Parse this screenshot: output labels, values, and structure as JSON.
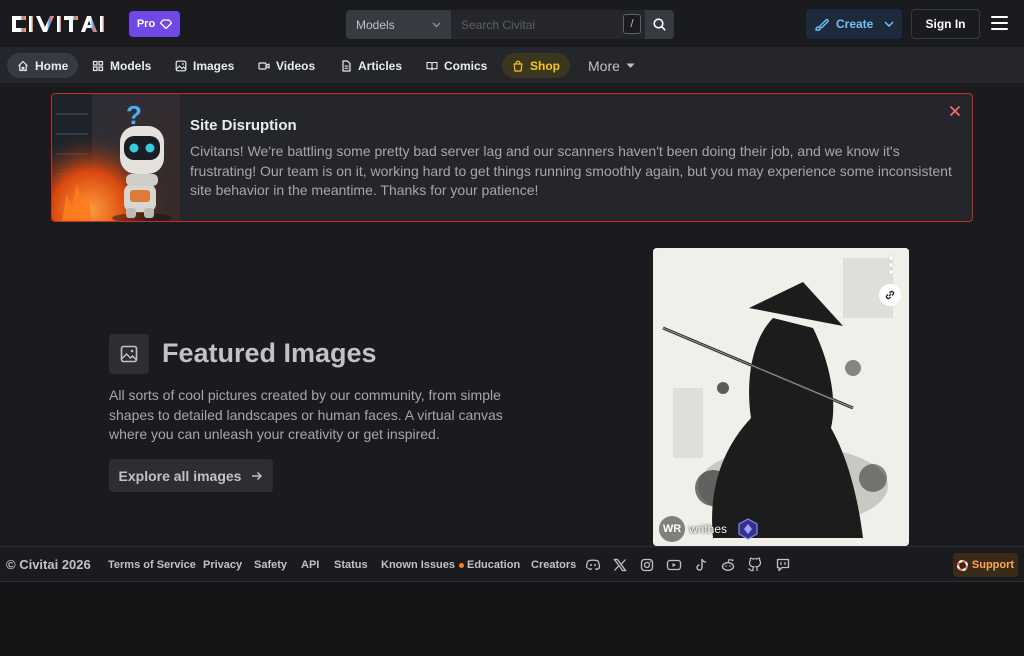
{
  "header": {
    "logo_text": "CIVITAI",
    "pro_label": "Pro",
    "search": {
      "scope": "Models",
      "placeholder": "Search Civitai",
      "shortcut": "/"
    },
    "create_label": "Create",
    "signin_label": "Sign In"
  },
  "nav": {
    "items": [
      {
        "label": "Home",
        "icon": "home-icon"
      },
      {
        "label": "Models",
        "icon": "grid-icon"
      },
      {
        "label": "Images",
        "icon": "photo-icon"
      },
      {
        "label": "Videos",
        "icon": "video-icon"
      },
      {
        "label": "Articles",
        "icon": "file-icon"
      },
      {
        "label": "Comics",
        "icon": "book-icon"
      },
      {
        "label": "Shop",
        "icon": "shopping-bag-icon"
      }
    ],
    "more_label": "More"
  },
  "alert": {
    "title": "Site Disruption",
    "message": "Civitans! We're battling some pretty bad server lag and our scanners haven't been doing their job, and we know it's frustrating! Our team is on it, working hard to get things running smoothly again, but you may experience some inconsistent site behavior in the meantime. Thanks for your patience!"
  },
  "featured": {
    "title": "Featured Images",
    "description": "All sorts of cool pictures created by our community, from simple shapes to detailed landscapes or human faces. A virtual canvas where you can unleash your creativity or get inspired.",
    "button_label": "Explore all images"
  },
  "card": {
    "avatar_initials": "WR",
    "username": "writhes"
  },
  "footer": {
    "copyright": "© Civitai 2026",
    "links": [
      "Terms of Service",
      "Privacy",
      "Safety",
      "API",
      "Status",
      "Known Issues",
      "Education",
      "Creators"
    ],
    "social_icons": [
      "discord-icon",
      "x-icon",
      "instagram-icon",
      "youtube-icon",
      "tiktok-icon",
      "reddit-icon",
      "github-icon",
      "message-icon"
    ],
    "support_label": "Support"
  },
  "colors": {
    "background": "#1a1b1e",
    "pro": "#7048e8",
    "create_accent": "#74c0fc",
    "shop_accent": "#fcc419",
    "alert_border": "#c92a2a",
    "support_accent": "#ffa94d",
    "status_dot": "#fd7e14"
  }
}
